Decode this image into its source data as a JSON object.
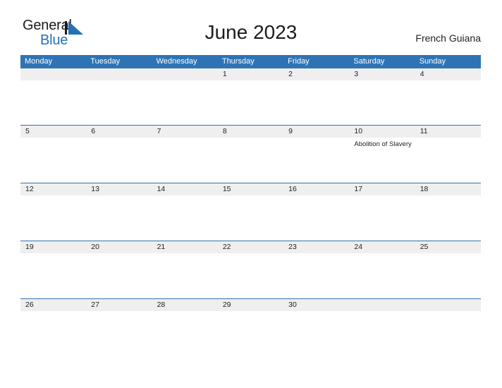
{
  "brand": {
    "word1": "General",
    "word2": "Blue",
    "mark": "triangle-logo-icon",
    "color_primary": "#2470b4",
    "color_text": "#1a1a1a"
  },
  "header": {
    "title": "June 2023",
    "region": "French Guiana"
  },
  "calendar": {
    "accent_color": "#2e74b5",
    "band_color": "#efefef",
    "weekdays": [
      "Monday",
      "Tuesday",
      "Wednesday",
      "Thursday",
      "Friday",
      "Saturday",
      "Sunday"
    ],
    "weeks": [
      {
        "days": [
          {
            "date": "",
            "events": []
          },
          {
            "date": "",
            "events": []
          },
          {
            "date": "",
            "events": []
          },
          {
            "date": "1",
            "events": []
          },
          {
            "date": "2",
            "events": []
          },
          {
            "date": "3",
            "events": []
          },
          {
            "date": "4",
            "events": []
          }
        ]
      },
      {
        "days": [
          {
            "date": "5",
            "events": []
          },
          {
            "date": "6",
            "events": []
          },
          {
            "date": "7",
            "events": []
          },
          {
            "date": "8",
            "events": []
          },
          {
            "date": "9",
            "events": []
          },
          {
            "date": "10",
            "events": [
              "Abolition of Slavery"
            ]
          },
          {
            "date": "11",
            "events": []
          }
        ]
      },
      {
        "days": [
          {
            "date": "12",
            "events": []
          },
          {
            "date": "13",
            "events": []
          },
          {
            "date": "14",
            "events": []
          },
          {
            "date": "15",
            "events": []
          },
          {
            "date": "16",
            "events": []
          },
          {
            "date": "17",
            "events": []
          },
          {
            "date": "18",
            "events": []
          }
        ]
      },
      {
        "days": [
          {
            "date": "19",
            "events": []
          },
          {
            "date": "20",
            "events": []
          },
          {
            "date": "21",
            "events": []
          },
          {
            "date": "22",
            "events": []
          },
          {
            "date": "23",
            "events": []
          },
          {
            "date": "24",
            "events": []
          },
          {
            "date": "25",
            "events": []
          }
        ]
      },
      {
        "days": [
          {
            "date": "26",
            "events": []
          },
          {
            "date": "27",
            "events": []
          },
          {
            "date": "28",
            "events": []
          },
          {
            "date": "29",
            "events": []
          },
          {
            "date": "30",
            "events": []
          },
          {
            "date": "",
            "events": []
          },
          {
            "date": "",
            "events": []
          }
        ]
      }
    ]
  }
}
